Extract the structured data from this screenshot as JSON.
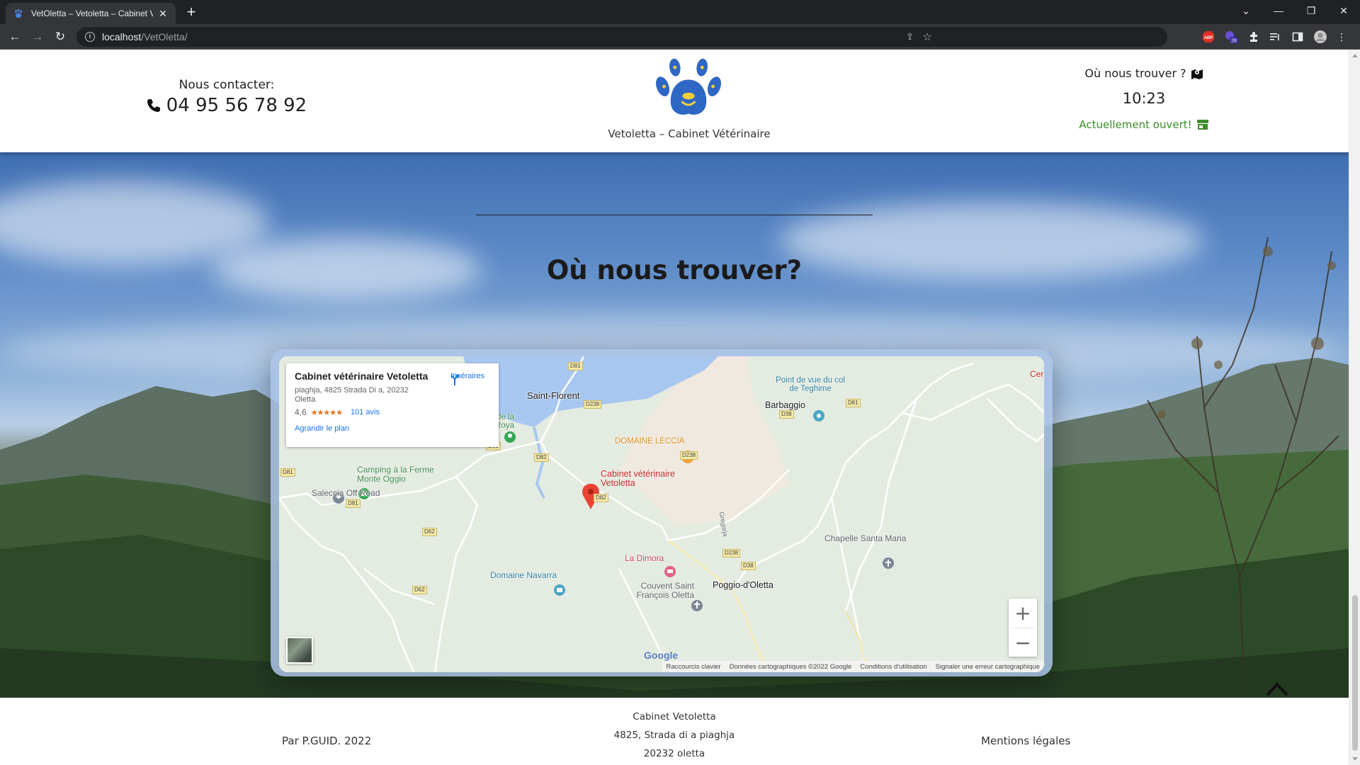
{
  "browser": {
    "tab_title": "VetOletta – Vetoletta – Cabinet V",
    "url_host": "localhost",
    "url_path": "/VetOletta/",
    "ext_badge": "28",
    "abp_label": "ABP"
  },
  "header": {
    "contact_label": "Nous contacter:",
    "phone": "04 95 56 78 92",
    "brand_name": "Vetoletta – Cabinet Vétérinaire",
    "find_us": "Où nous trouver ?",
    "clock": "10:23",
    "open_status": "Actuellement ouvert!"
  },
  "section": {
    "title": "Où nous trouver?"
  },
  "map": {
    "place_name": "Cabinet vétérinaire Vetoletta",
    "address": "piaghja, 4825 Strada Di a, 20232 Oletta",
    "rating": "4,6",
    "stars": "★★★★★",
    "reviews": "101 avis",
    "enlarge": "Agrandir le plan",
    "directions": "Itinéraires",
    "zoom_in": "+",
    "zoom_out": "−",
    "labels": {
      "saint_florent": "Saint-Florent",
      "plage": "Plage de la Roya",
      "camping": "Camping à la Ferme Monte Oggio",
      "saleccia": "Saleccia Off Road",
      "domaine_leccia": "DOMAINE LECCIA",
      "cabinet": "Cabinet vétérinaire Vetoletta",
      "la_dimora": "La Dimora",
      "domaine_navarra": "Domaine Navarra",
      "couvent": "Couvent Saint François Oletta",
      "poggio": "Poggio-d'Oletta",
      "barbaggio": "Barbaggio",
      "point_de_vue": "Point de vue du col de Teghime",
      "chapelle": "Chapelle Santa Maria",
      "cer": "Cer",
      "gregorja": "Gregorja"
    },
    "roads": {
      "d81a": "D81",
      "d81b": "D81",
      "d81c": "D81",
      "d81d": "D81",
      "d81e": "D81",
      "d238a": "D238",
      "d238b": "D238",
      "d238c": "D238",
      "d82a": "D82",
      "d82b": "D82",
      "d62a": "D62",
      "d62b": "D62",
      "d38a": "D38",
      "d38b": "D38"
    },
    "footer": {
      "shortcuts": "Raccourcis clavier",
      "mapdata": "Données cartographiques ©2022 Google",
      "terms": "Conditions d'utilisation",
      "report": "Signaler une erreur cartographique"
    },
    "google": "Google"
  },
  "footer": {
    "credit": "Par P.GUID. 2022",
    "business": "Cabinet Vetoletta",
    "street": "4825, Strada di a piaghja",
    "city": "20232 oletta",
    "legal": "Mentions légales"
  }
}
